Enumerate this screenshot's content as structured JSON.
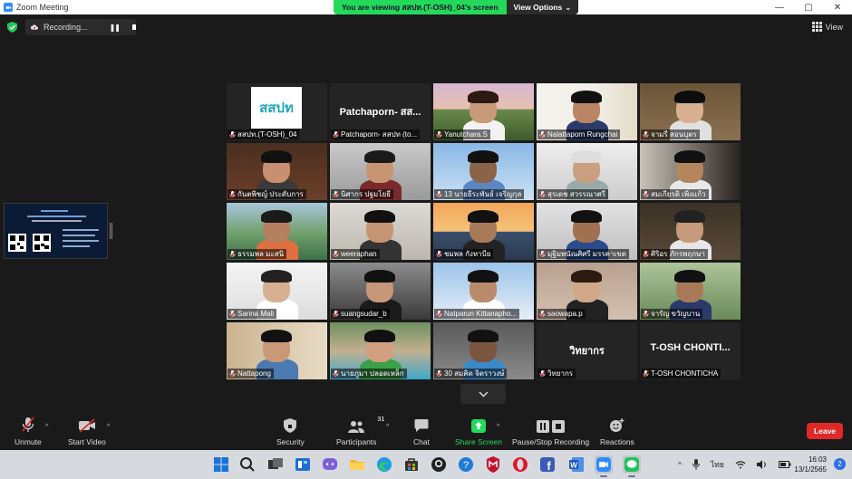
{
  "window": {
    "title": "Zoom Meeting"
  },
  "share_banner": {
    "viewing_text": "You are viewing สสปท.(T-OSH)_04's screen",
    "view_options": "View Options"
  },
  "recording": {
    "label": "Recording..."
  },
  "view": {
    "label": "View"
  },
  "participants": [
    {
      "name": "สสปท.(T-OSH)_04",
      "kind": "logo",
      "logo_text": "สสปท"
    },
    {
      "name": "Patchaporn- สสปท (to...",
      "kind": "name",
      "display": "Patchaporn- สส..."
    },
    {
      "name": "Yanutchara.S",
      "kind": "video"
    },
    {
      "name": "Nalattaporn Rungchai",
      "kind": "video"
    },
    {
      "name": "จามรี สอนบุตร",
      "kind": "video"
    },
    {
      "name": "กันตพิชญ์ ประดับการ",
      "kind": "video"
    },
    {
      "name": "นิศากร ปฐมโยธี",
      "kind": "video"
    },
    {
      "name": "13 นายธีระพันธ์ เจริญกุล",
      "kind": "video"
    },
    {
      "name": "สุรเดช สวรรณาศรี",
      "kind": "video"
    },
    {
      "name": "สมเกียรติ เพิ่งแก้ว",
      "kind": "video"
    },
    {
      "name": "ธรรมพล มะสนิ",
      "kind": "video"
    },
    {
      "name": "weeraphan",
      "kind": "video"
    },
    {
      "name": "ชมพล กังหาบีย",
      "kind": "video"
    },
    {
      "name": "มุฐิมพนัณศิศรี มรรคาเขต",
      "kind": "video"
    },
    {
      "name": "ศิริอร ภักรพฤกษา",
      "kind": "video"
    },
    {
      "name": "Sarina Mali",
      "kind": "video"
    },
    {
      "name": "suangsudar_b",
      "kind": "video"
    },
    {
      "name": "Natparun Kittanapho...",
      "kind": "video"
    },
    {
      "name": "saowapa.p",
      "kind": "video"
    },
    {
      "name": "จารัญ ขวัญบาน",
      "kind": "video"
    },
    {
      "name": "Nattapong",
      "kind": "video"
    },
    {
      "name": "นายภูมา ปลอดเหล็ก",
      "kind": "video",
      "active": true
    },
    {
      "name": "30 สมคิด จิตราวงษ์",
      "kind": "video"
    },
    {
      "name": "วิทยากร",
      "kind": "name",
      "display": "วิทยากร"
    },
    {
      "name": "T-OSH CHONTICHA",
      "kind": "name",
      "display": "T-OSH CHONTI..."
    }
  ],
  "toolbar": {
    "unmute": "Unmute",
    "start_video": "Start Video",
    "security": "Security",
    "participants": "Participants",
    "participants_count": "31",
    "chat": "Chat",
    "share_screen": "Share Screen",
    "record": "Pause/Stop Recording",
    "reactions": "Reactions",
    "leave": "Leave"
  },
  "taskbar": {
    "lang": "ไทย",
    "time": "16:03",
    "date": "13/1/2565",
    "notifications": "2"
  },
  "colors": {
    "share_green": "#23d959",
    "leave_red": "#e02828",
    "active_speaker": "#d8ff70"
  }
}
